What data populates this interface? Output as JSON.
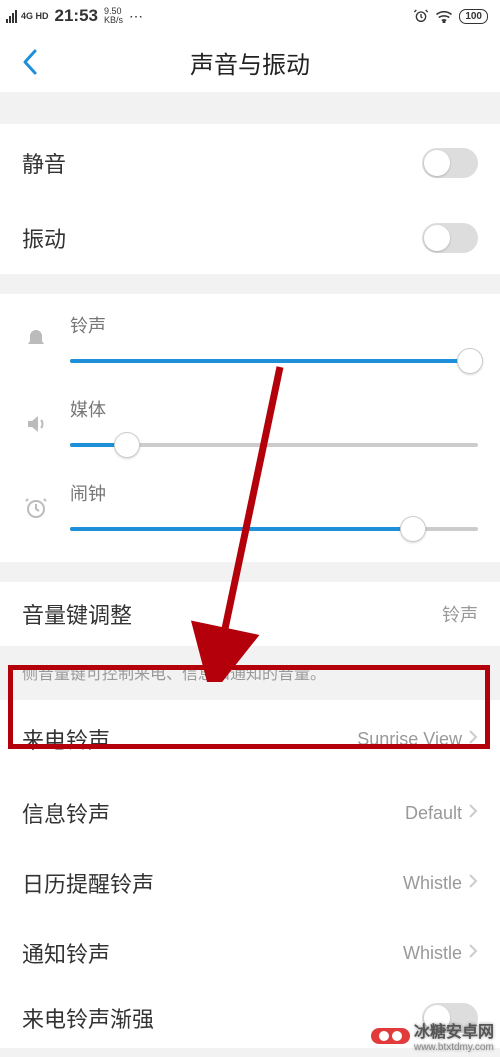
{
  "statusbar": {
    "network_gen": "4G HD",
    "time": "21:53",
    "speed_value": "9.50",
    "speed_unit": "KB/s",
    "battery": "100"
  },
  "nav": {
    "title": "声音与振动"
  },
  "toggles": {
    "mute_label": "静音",
    "mute_on": false,
    "vibrate_label": "振动",
    "vibrate_on": false
  },
  "sliders": {
    "ringtone_label": "铃声",
    "ringtone_percent": 98,
    "media_label": "媒体",
    "media_percent": 14,
    "alarm_label": "闹钟",
    "alarm_percent": 84
  },
  "volume_key": {
    "label": "音量键调整",
    "value": "铃声",
    "description": "侧音量键可控制来电、信息和通知的音量。"
  },
  "ringtones": [
    {
      "label": "来电铃声",
      "value": "Sunrise View"
    },
    {
      "label": "信息铃声",
      "value": "Default"
    },
    {
      "label": "日历提醒铃声",
      "value": "Whistle"
    },
    {
      "label": "通知铃声",
      "value": "Whistle"
    }
  ],
  "crescendo": {
    "label": "来电铃声渐强",
    "on": false
  },
  "watermark": {
    "brand_text": "冰糖安卓网",
    "url": "www.btxtdmy.com"
  }
}
